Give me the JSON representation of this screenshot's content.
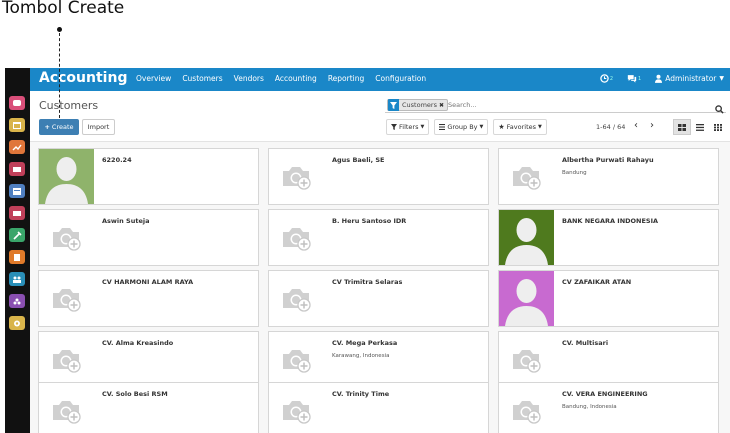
{
  "annotation": {
    "label": "Tombol Create"
  },
  "navbar": {
    "brand": "Accounting",
    "menu": [
      "Overview",
      "Customers",
      "Vendors",
      "Accounting",
      "Reporting",
      "Configuration"
    ],
    "activity_count": "2",
    "message_count": "1",
    "user": "Administrator"
  },
  "control_panel": {
    "breadcrumb": "Customers",
    "create_label": "Create",
    "import_label": "Import",
    "facet_label": "Customers",
    "search_placeholder": "Search...",
    "filters_label": "Filters",
    "groupby_label": "Group By",
    "favorites_label": "Favorites",
    "pager": "1-64 / 64"
  },
  "colors": {
    "navbar": "#1a87c8",
    "create_button": "#3d7fb3",
    "appbar": "#111111"
  },
  "cards": [
    {
      "name": "6220.24",
      "sub": "",
      "image": "avatar-green"
    },
    {
      "name": "Agus Baeli, SE",
      "sub": "",
      "image": "camera-placeholder"
    },
    {
      "name": "Albertha Purwati Rahayu",
      "sub": "Bandung",
      "image": "camera-placeholder"
    },
    {
      "name": "Aswin Suteja",
      "sub": "",
      "image": "camera-placeholder"
    },
    {
      "name": "B. Heru Santoso IDR",
      "sub": "",
      "image": "camera-placeholder"
    },
    {
      "name": "BANK NEGARA INDONESIA",
      "sub": "",
      "image": "avatar-darkgreen"
    },
    {
      "name": "CV HARMONI ALAM RAYA",
      "sub": "",
      "image": "camera-placeholder"
    },
    {
      "name": "CV Trimitra Selaras",
      "sub": "",
      "image": "camera-placeholder"
    },
    {
      "name": "CV ZAFAIKAR ATAN",
      "sub": "",
      "image": "avatar-purple"
    },
    {
      "name": "CV. Alma Kreasindo",
      "sub": "",
      "image": "camera-placeholder"
    },
    {
      "name": "CV. Mega Perkasa",
      "sub": "Karawang, Indonesia",
      "image": "camera-placeholder"
    },
    {
      "name": "CV. Multisari",
      "sub": "",
      "image": "camera-placeholder"
    },
    {
      "name": "CV. Solo Besi RSM",
      "sub": "",
      "image": "camera-placeholder"
    },
    {
      "name": "CV. Trinity Time",
      "sub": "",
      "image": "camera-placeholder"
    },
    {
      "name": "CV. VERA ENGINEERING",
      "sub": "Bandung, Indonesia",
      "image": "camera-placeholder"
    }
  ]
}
